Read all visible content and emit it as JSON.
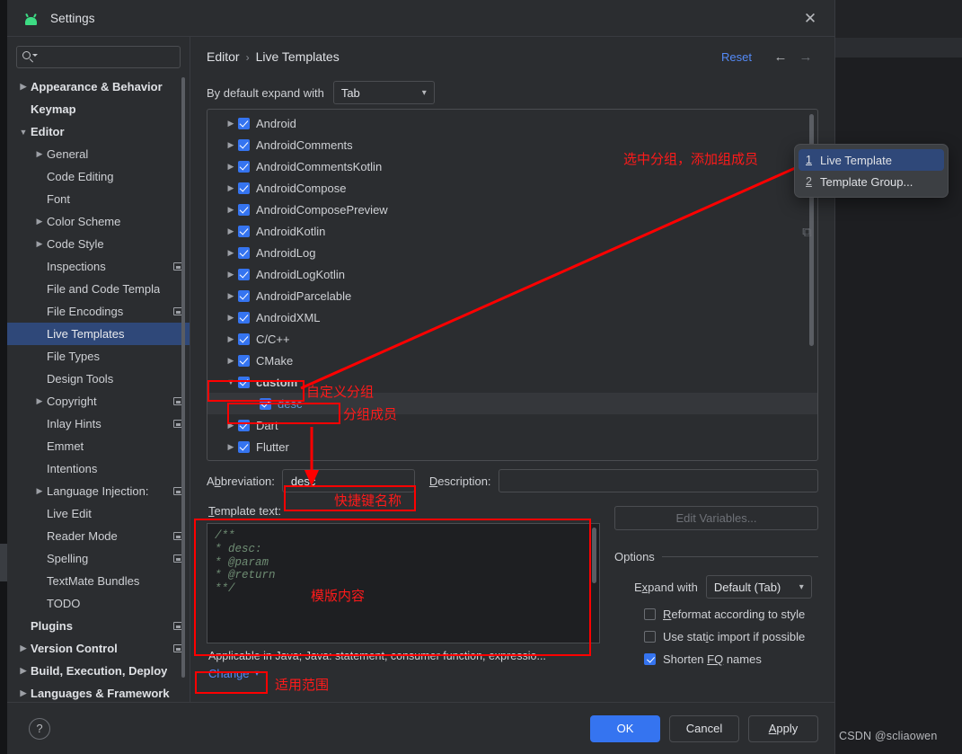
{
  "window": {
    "title": "Settings",
    "app_icon": "android-robot-icon",
    "close_icon": "close-icon"
  },
  "search": {
    "value": "",
    "placeholder": "",
    "icon": "search-icon"
  },
  "sidebar": {
    "items": [
      {
        "label": "Appearance & Behavior",
        "arrow": "collapsed",
        "bold": true,
        "badge": false,
        "selected": false,
        "indent": 0
      },
      {
        "label": "Keymap",
        "arrow": "none",
        "bold": true,
        "badge": false,
        "selected": false,
        "indent": 0
      },
      {
        "label": "Editor",
        "arrow": "expanded",
        "bold": true,
        "badge": false,
        "selected": false,
        "indent": 0
      },
      {
        "label": "General",
        "arrow": "collapsed",
        "bold": false,
        "badge": false,
        "selected": false,
        "indent": 1
      },
      {
        "label": "Code Editing",
        "arrow": "none",
        "bold": false,
        "badge": false,
        "selected": false,
        "indent": 1
      },
      {
        "label": "Font",
        "arrow": "none",
        "bold": false,
        "badge": false,
        "selected": false,
        "indent": 1
      },
      {
        "label": "Color Scheme",
        "arrow": "collapsed",
        "bold": false,
        "badge": false,
        "selected": false,
        "indent": 1
      },
      {
        "label": "Code Style",
        "arrow": "collapsed",
        "bold": false,
        "badge": false,
        "selected": false,
        "indent": 1
      },
      {
        "label": "Inspections",
        "arrow": "none",
        "bold": false,
        "badge": true,
        "selected": false,
        "indent": 1
      },
      {
        "label": "File and Code Templa",
        "arrow": "none",
        "bold": false,
        "badge": false,
        "selected": false,
        "indent": 1
      },
      {
        "label": "File Encodings",
        "arrow": "none",
        "bold": false,
        "badge": true,
        "selected": false,
        "indent": 1
      },
      {
        "label": "Live Templates",
        "arrow": "none",
        "bold": false,
        "badge": false,
        "selected": true,
        "indent": 1
      },
      {
        "label": "File Types",
        "arrow": "none",
        "bold": false,
        "badge": false,
        "selected": false,
        "indent": 1
      },
      {
        "label": "Design Tools",
        "arrow": "none",
        "bold": false,
        "badge": false,
        "selected": false,
        "indent": 1
      },
      {
        "label": "Copyright",
        "arrow": "collapsed",
        "bold": false,
        "badge": true,
        "selected": false,
        "indent": 1
      },
      {
        "label": "Inlay Hints",
        "arrow": "none",
        "bold": false,
        "badge": true,
        "selected": false,
        "indent": 1
      },
      {
        "label": "Emmet",
        "arrow": "none",
        "bold": false,
        "badge": false,
        "selected": false,
        "indent": 1
      },
      {
        "label": "Intentions",
        "arrow": "none",
        "bold": false,
        "badge": false,
        "selected": false,
        "indent": 1
      },
      {
        "label": "Language Injection:",
        "arrow": "collapsed",
        "bold": false,
        "badge": true,
        "selected": false,
        "indent": 1
      },
      {
        "label": "Live Edit",
        "arrow": "none",
        "bold": false,
        "badge": false,
        "selected": false,
        "indent": 1
      },
      {
        "label": "Reader Mode",
        "arrow": "none",
        "bold": false,
        "badge": true,
        "selected": false,
        "indent": 1
      },
      {
        "label": "Spelling",
        "arrow": "none",
        "bold": false,
        "badge": true,
        "selected": false,
        "indent": 1
      },
      {
        "label": "TextMate Bundles",
        "arrow": "none",
        "bold": false,
        "badge": false,
        "selected": false,
        "indent": 1
      },
      {
        "label": "TODO",
        "arrow": "none",
        "bold": false,
        "badge": false,
        "selected": false,
        "indent": 1
      },
      {
        "label": "Plugins",
        "arrow": "none",
        "bold": true,
        "badge": true,
        "selected": false,
        "indent": 0
      },
      {
        "label": "Version Control",
        "arrow": "collapsed",
        "bold": true,
        "badge": true,
        "selected": false,
        "indent": 0
      },
      {
        "label": "Build, Execution, Deploy",
        "arrow": "collapsed",
        "bold": true,
        "badge": false,
        "selected": false,
        "indent": 0
      },
      {
        "label": "Languages & Framework",
        "arrow": "collapsed",
        "bold": true,
        "badge": false,
        "selected": false,
        "indent": 0
      }
    ]
  },
  "header": {
    "breadcrumb_root": "Editor",
    "breadcrumb_sep": "›",
    "breadcrumb_leaf": "Live Templates",
    "reset_label": "Reset",
    "back_icon": "arrow-left-icon",
    "forward_icon": "arrow-right-icon"
  },
  "expand_with": {
    "label": "By default expand with",
    "value": "Tab",
    "chevron": "chevron-down-icon"
  },
  "template_tree": {
    "rows": [
      {
        "label": "Android",
        "arrow": "collapsed",
        "checked": true,
        "child": false,
        "selected": false
      },
      {
        "label": "AndroidComments",
        "arrow": "collapsed",
        "checked": true,
        "child": false,
        "selected": false
      },
      {
        "label": "AndroidCommentsKotlin",
        "arrow": "collapsed",
        "checked": true,
        "child": false,
        "selected": false
      },
      {
        "label": "AndroidCompose",
        "arrow": "collapsed",
        "checked": true,
        "child": false,
        "selected": false
      },
      {
        "label": "AndroidComposePreview",
        "arrow": "collapsed",
        "checked": true,
        "child": false,
        "selected": false
      },
      {
        "label": "AndroidKotlin",
        "arrow": "collapsed",
        "checked": true,
        "child": false,
        "selected": false
      },
      {
        "label": "AndroidLog",
        "arrow": "collapsed",
        "checked": true,
        "child": false,
        "selected": false
      },
      {
        "label": "AndroidLogKotlin",
        "arrow": "collapsed",
        "checked": true,
        "child": false,
        "selected": false
      },
      {
        "label": "AndroidParcelable",
        "arrow": "collapsed",
        "checked": true,
        "child": false,
        "selected": false
      },
      {
        "label": "AndroidXML",
        "arrow": "collapsed",
        "checked": true,
        "child": false,
        "selected": false
      },
      {
        "label": "C/C++",
        "arrow": "collapsed",
        "checked": true,
        "child": false,
        "selected": false
      },
      {
        "label": "CMake",
        "arrow": "collapsed",
        "checked": true,
        "child": false,
        "selected": false
      },
      {
        "label": "custom",
        "arrow": "expanded",
        "checked": true,
        "child": false,
        "selected": false,
        "bold": true
      },
      {
        "label": "desc",
        "arrow": "none",
        "checked": true,
        "child": true,
        "selected": true
      },
      {
        "label": "Dart",
        "arrow": "collapsed",
        "checked": true,
        "child": false,
        "selected": false
      },
      {
        "label": "Flutter",
        "arrow": "collapsed",
        "checked": true,
        "child": false,
        "selected": false
      }
    ],
    "add_button_icon": "plus-icon",
    "secondary_button_icon": "copy-icon"
  },
  "popup_menu": {
    "items": [
      {
        "num": "1",
        "label": "Live Template",
        "active": true
      },
      {
        "num": "2",
        "label": "Template Group...",
        "active": false
      }
    ]
  },
  "fields": {
    "abbreviation_label": "Abbreviation:",
    "abbreviation_label_mnemonic": "b",
    "abbreviation_value": "desc",
    "description_label": "Description:",
    "description_label_mnemonic": "D",
    "description_value": "",
    "template_text_label": "Template text:",
    "template_text_mnemonic": "T",
    "template_text": "/**\n* desc:\n* @param\n* @return\n**/",
    "applicable_text": "Applicable in Java; Java: statement, consumer function, expressio...",
    "change_label": "Change",
    "change_chevron": "chevron-down-icon"
  },
  "options": {
    "edit_variables_label": "Edit Variables...",
    "legend": "Options",
    "expand_with_label": "Expand with",
    "expand_with_mnemonic": "x",
    "expand_with_value": "Default (Tab)",
    "checkboxes": [
      {
        "label": "Reformat according to style",
        "mnemonic": "R",
        "checked": false
      },
      {
        "label": "Use static import if possible",
        "mnemonic": "i",
        "checked": false
      },
      {
        "label": "Shorten FQ names",
        "mnemonic": "FQ",
        "checked": true
      }
    ]
  },
  "footer": {
    "help_icon": "help-icon",
    "ok_label": "OK",
    "cancel_label": "Cancel",
    "apply_label": "Apply",
    "apply_mnemonic": "A"
  },
  "annotations": {
    "accent_color": "#ff0000",
    "select_group_add_member": "选中分组，添加组成员",
    "custom_group": "自定义分组",
    "group_member": "分组成员",
    "shortcut_name": "快捷键名称",
    "template_content": "模版内容",
    "applicable_scope": "适用范围"
  },
  "watermark": "CSDN @scliaowen"
}
